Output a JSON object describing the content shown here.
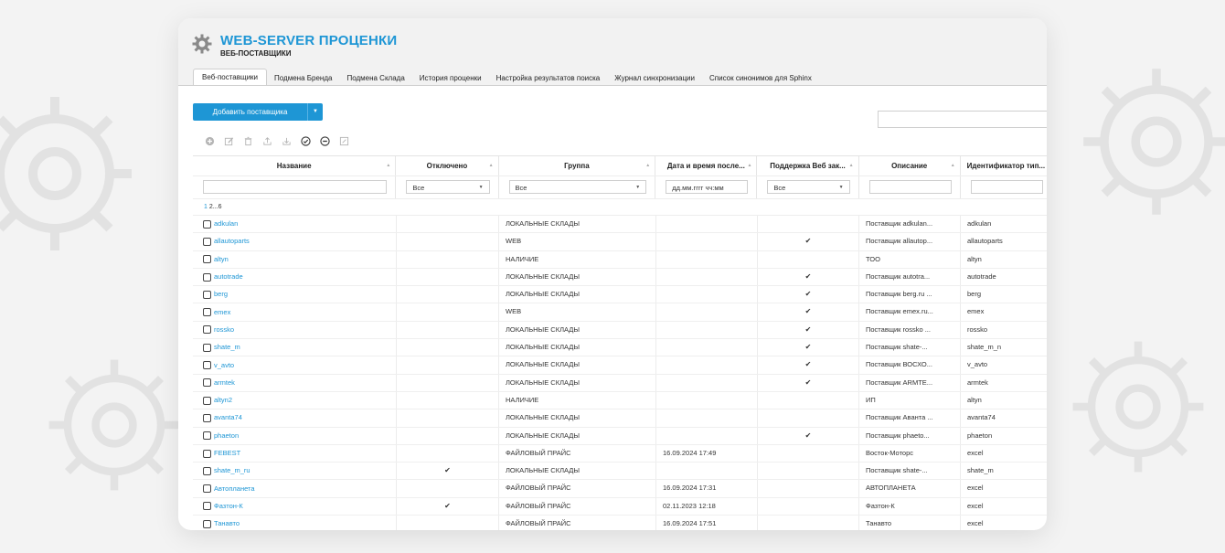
{
  "app": {
    "title": "WEB-SERVER ПРОЦЕНКИ",
    "subtitle": "ВЕБ-ПОСТАВЩИКИ",
    "logo_icon": "gear-icon",
    "accent_color": "#1e96d5"
  },
  "tabs": [
    {
      "label": "Веб-поставщики",
      "active": true
    },
    {
      "label": "Подмена Бренда",
      "active": false
    },
    {
      "label": "Подмена Склада",
      "active": false
    },
    {
      "label": "История проценки",
      "active": false
    },
    {
      "label": "Настройка результатов поиска",
      "active": false
    },
    {
      "label": "Журнал синхронизации",
      "active": false
    },
    {
      "label": "Список синонимов для Sphinx",
      "active": false
    }
  ],
  "actions": {
    "add_supplier_label": "Добавить поставщика"
  },
  "search": {
    "value": "",
    "placeholder": ""
  },
  "toolbar": [
    {
      "icon": "add-circle-icon"
    },
    {
      "icon": "edit-icon"
    },
    {
      "icon": "delete-icon"
    },
    {
      "icon": "export-icon"
    },
    {
      "icon": "import-icon"
    },
    {
      "icon": "check-circle-icon"
    },
    {
      "icon": "minus-circle-icon"
    },
    {
      "icon": "settings-edit-icon"
    }
  ],
  "columns": [
    {
      "label": "Название",
      "filter": ""
    },
    {
      "label": "Отключено",
      "filter": "Все"
    },
    {
      "label": "Группа",
      "filter": "Все"
    },
    {
      "label": "Дата и время после...",
      "filter": "дд.мм.гггг чч:мм"
    },
    {
      "label": "Поддержка Веб зак...",
      "filter": "Все"
    },
    {
      "label": "Описание",
      "filter": ""
    },
    {
      "label": "Идентификатор тип...",
      "filter": ""
    }
  ],
  "pager": {
    "p1": "1",
    "p2": "2",
    "dots": "...",
    "last": "6"
  },
  "rows": [
    {
      "name": "adkulan",
      "disabled": "",
      "group": "ЛОКАЛЬНЫЕ СКЛАДЫ",
      "date": "",
      "web": "",
      "desc": "Поставщик adkulan...",
      "type": "adkulan"
    },
    {
      "name": "allautoparts",
      "disabled": "",
      "group": "WEB",
      "date": "",
      "web": "✔",
      "desc": "Поставщик allautop...",
      "type": "allautoparts"
    },
    {
      "name": "altyn",
      "disabled": "",
      "group": "НАЛИЧИЕ",
      "date": "",
      "web": "",
      "desc": "ТОО",
      "type": "altyn"
    },
    {
      "name": "autotrade",
      "disabled": "",
      "group": "ЛОКАЛЬНЫЕ СКЛАДЫ",
      "date": "",
      "web": "✔",
      "desc": "Поставщик autotra...",
      "type": "autotrade"
    },
    {
      "name": "berg",
      "disabled": "",
      "group": "ЛОКАЛЬНЫЕ СКЛАДЫ",
      "date": "",
      "web": "✔",
      "desc": "Поставщик berg.ru ...",
      "type": "berg"
    },
    {
      "name": "emex",
      "disabled": "",
      "group": "WEB",
      "date": "",
      "web": "✔",
      "desc": "Поставщик emex.ru...",
      "type": "emex"
    },
    {
      "name": "rossko",
      "disabled": "",
      "group": "ЛОКАЛЬНЫЕ СКЛАДЫ",
      "date": "",
      "web": "✔",
      "desc": "Поставщик rossko ...",
      "type": "rossko"
    },
    {
      "name": "shate_m",
      "disabled": "",
      "group": "ЛОКАЛЬНЫЕ СКЛАДЫ",
      "date": "",
      "web": "✔",
      "desc": "Поставщик shate-...",
      "type": "shate_m_n"
    },
    {
      "name": "v_avto",
      "disabled": "",
      "group": "ЛОКАЛЬНЫЕ СКЛАДЫ",
      "date": "",
      "web": "✔",
      "desc": "Поставщик ВОСХО...",
      "type": "v_avto"
    },
    {
      "name": "armtek",
      "disabled": "",
      "group": "ЛОКАЛЬНЫЕ СКЛАДЫ",
      "date": "",
      "web": "✔",
      "desc": "Поставщик ARMTE...",
      "type": "armtek"
    },
    {
      "name": "altyn2",
      "disabled": "",
      "group": "НАЛИЧИЕ",
      "date": "",
      "web": "",
      "desc": "ИП",
      "type": "altyn"
    },
    {
      "name": "avanta74",
      "disabled": "",
      "group": "ЛОКАЛЬНЫЕ СКЛАДЫ",
      "date": "",
      "web": "",
      "desc": "Поставщик Аванта ...",
      "type": "avanta74"
    },
    {
      "name": "phaeton",
      "disabled": "",
      "group": "ЛОКАЛЬНЫЕ СКЛАДЫ",
      "date": "",
      "web": "✔",
      "desc": "Поставщик phaeto...",
      "type": "phaeton"
    },
    {
      "name": "FEBEST",
      "disabled": "",
      "group": "ФАЙЛОВЫЙ ПРАЙС",
      "date": "16.09.2024 17:49",
      "web": "",
      "desc": "Восток-Моторс",
      "type": "excel"
    },
    {
      "name": "shate_m_ru",
      "disabled": "✔",
      "group": "ЛОКАЛЬНЫЕ СКЛАДЫ",
      "date": "",
      "web": "",
      "desc": "Поставщик shate-...",
      "type": "shate_m"
    },
    {
      "name": "Автопланета",
      "disabled": "",
      "group": "ФАЙЛОВЫЙ ПРАЙС",
      "date": "16.09.2024 17:31",
      "web": "",
      "desc": "АВТОПЛАНЕТА",
      "type": "excel"
    },
    {
      "name": "Фазтон-К",
      "disabled": "✔",
      "group": "ФАЙЛОВЫЙ ПРАЙС",
      "date": "02.11.2023 12:18",
      "web": "",
      "desc": "Фазтон-К",
      "type": "excel"
    },
    {
      "name": "Танавто",
      "disabled": "",
      "group": "ФАЙЛОВЫЙ ПРАЙС",
      "date": "16.09.2024 17:51",
      "web": "",
      "desc": "Танавто",
      "type": "excel"
    }
  ]
}
